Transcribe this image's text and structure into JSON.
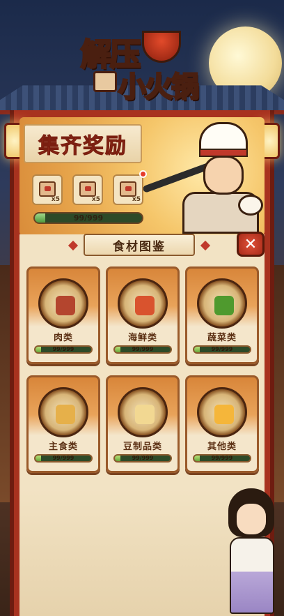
{
  "game": {
    "logo": {
      "line1": "解压",
      "line2": "小火锅"
    }
  },
  "banner": {
    "title": "集齐奖励",
    "rewards": [
      {
        "qty": "x5"
      },
      {
        "qty": "x5"
      },
      {
        "qty": "x5"
      }
    ],
    "progress_text": "99/999",
    "progress_fraction": 0.099
  },
  "panel": {
    "header": "食材图鉴",
    "close_label": "✕",
    "categories": [
      {
        "name": "肉类",
        "progress": "99/999",
        "fraction": 0.099,
        "food_color": "#b4452e"
      },
      {
        "name": "海鲜类",
        "progress": "99/999",
        "fraction": 0.099,
        "food_color": "#d9532e"
      },
      {
        "name": "蔬菜类",
        "progress": "99/999",
        "fraction": 0.099,
        "food_color": "#4f9a2e"
      },
      {
        "name": "主食类",
        "progress": "99/999",
        "fraction": 0.099,
        "food_color": "#e6b04a"
      },
      {
        "name": "豆制品类",
        "progress": "99/999",
        "fraction": 0.099,
        "food_color": "#f2d892"
      },
      {
        "name": "其他类",
        "progress": "99/999",
        "fraction": 0.099,
        "food_color": "#f5b63a"
      }
    ]
  },
  "colors": {
    "frame_red": "#a8321f",
    "progress_green": "#4f9a3e",
    "accent_red": "#c0392b"
  }
}
